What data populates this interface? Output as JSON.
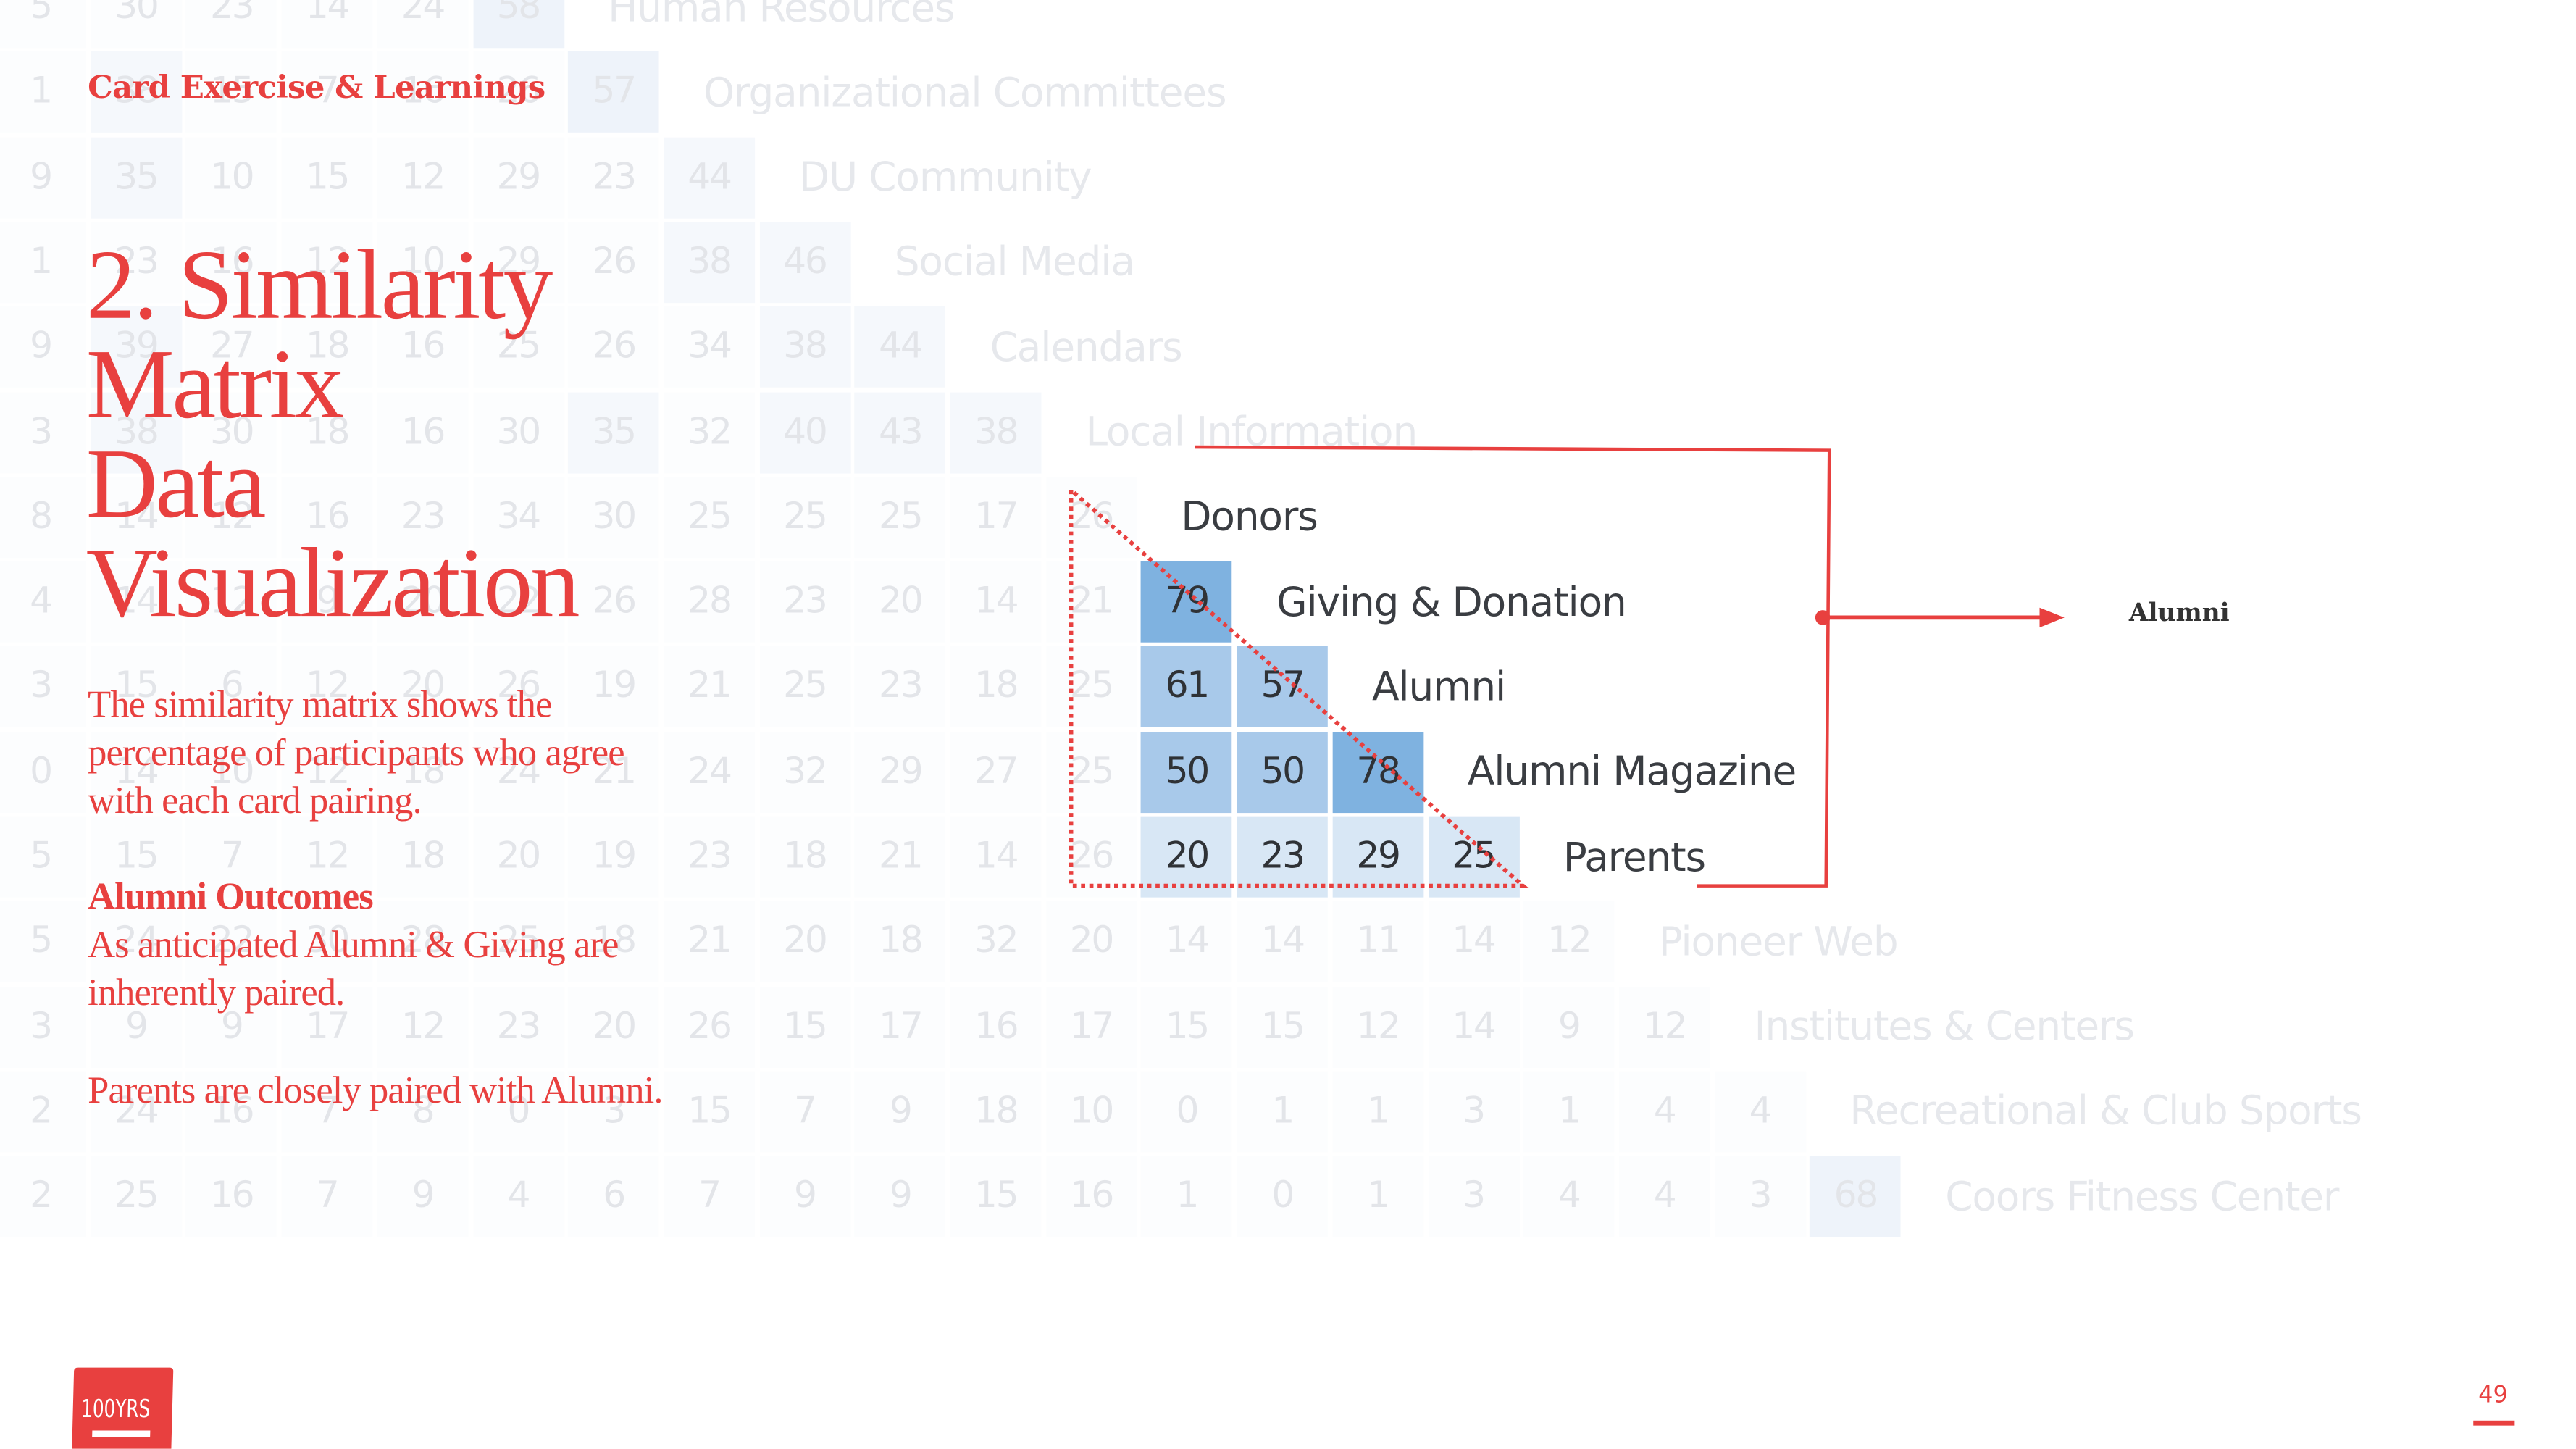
{
  "header": {
    "kicker": "Card Exercise & Learnings"
  },
  "title_lines": [
    "2. Similarity",
    "Matrix",
    "Data",
    "Visualization"
  ],
  "intro_lines": [
    "The similarity matrix shows the",
    "percentage of participants who agree",
    "with each card pairing."
  ],
  "outcomes": {
    "heading": "Alumni Outcomes",
    "lines": [
      "As anticipated Alumni & Giving are",
      "inherently paired."
    ],
    "note": "Parents are closely paired with Alumni."
  },
  "callout": {
    "label": "Alumni"
  },
  "page_number": "49",
  "logo_text": "100YRS",
  "colors": {
    "accent": "#e8403f",
    "cell_high": "#7fb2e0",
    "cell_mid": "#a8c9ea",
    "cell_low": "#d8e7f5"
  },
  "matrix": {
    "highlighted_rows": [
      "Donors",
      "Giving & Donation",
      "Alumni",
      "Alumni Magazine",
      "Parents"
    ],
    "rows": [
      {
        "label": "Human Resources",
        "values": [
          5,
          30,
          23,
          14,
          24,
          58
        ]
      },
      {
        "label": "Organizational Committees",
        "values": [
          1,
          38,
          15,
          7,
          16,
          26,
          57
        ]
      },
      {
        "label": "DU Community",
        "values": [
          9,
          35,
          10,
          15,
          12,
          29,
          23,
          44
        ]
      },
      {
        "label": "Social Media",
        "values": [
          1,
          23,
          16,
          12,
          10,
          29,
          26,
          38,
          46
        ]
      },
      {
        "label": "Calendars",
        "values": [
          9,
          39,
          27,
          18,
          16,
          25,
          26,
          34,
          38,
          44
        ]
      },
      {
        "label": "Local Information",
        "values": [
          3,
          38,
          30,
          18,
          16,
          30,
          35,
          32,
          40,
          43,
          38
        ]
      },
      {
        "label": "Donors",
        "values": [
          8,
          14,
          12,
          16,
          23,
          34,
          30,
          25,
          25,
          25,
          17,
          26
        ]
      },
      {
        "label": "Giving & Donation",
        "values": [
          4,
          14,
          12,
          9,
          20,
          22,
          26,
          28,
          23,
          20,
          14,
          21,
          79
        ]
      },
      {
        "label": "Alumni",
        "values": [
          3,
          15,
          6,
          12,
          20,
          26,
          19,
          21,
          25,
          23,
          18,
          25,
          61,
          57
        ]
      },
      {
        "label": "Alumni Magazine",
        "values": [
          0,
          14,
          10,
          12,
          18,
          24,
          21,
          24,
          32,
          29,
          27,
          25,
          50,
          50,
          78
        ]
      },
      {
        "label": "Parents",
        "values": [
          5,
          15,
          7,
          12,
          18,
          20,
          19,
          23,
          18,
          21,
          14,
          26,
          20,
          23,
          29,
          25
        ]
      },
      {
        "label": "Pioneer Web",
        "values": [
          5,
          24,
          22,
          30,
          28,
          25,
          18,
          21,
          20,
          18,
          32,
          20,
          14,
          14,
          11,
          14,
          12
        ]
      },
      {
        "label": "Institutes & Centers",
        "values": [
          3,
          9,
          9,
          17,
          12,
          23,
          20,
          26,
          15,
          17,
          16,
          17,
          15,
          15,
          12,
          14,
          9,
          12
        ]
      },
      {
        "label": "Recreational & Club Sports",
        "values": [
          2,
          24,
          16,
          7,
          8,
          0,
          3,
          15,
          7,
          9,
          18,
          10,
          0,
          1,
          1,
          3,
          1,
          4,
          4
        ]
      },
      {
        "label": "Coors Fitness Center",
        "values": [
          2,
          25,
          16,
          7,
          9,
          4,
          6,
          7,
          9,
          9,
          15,
          16,
          1,
          0,
          1,
          3,
          4,
          4,
          3,
          68
        ]
      }
    ]
  }
}
